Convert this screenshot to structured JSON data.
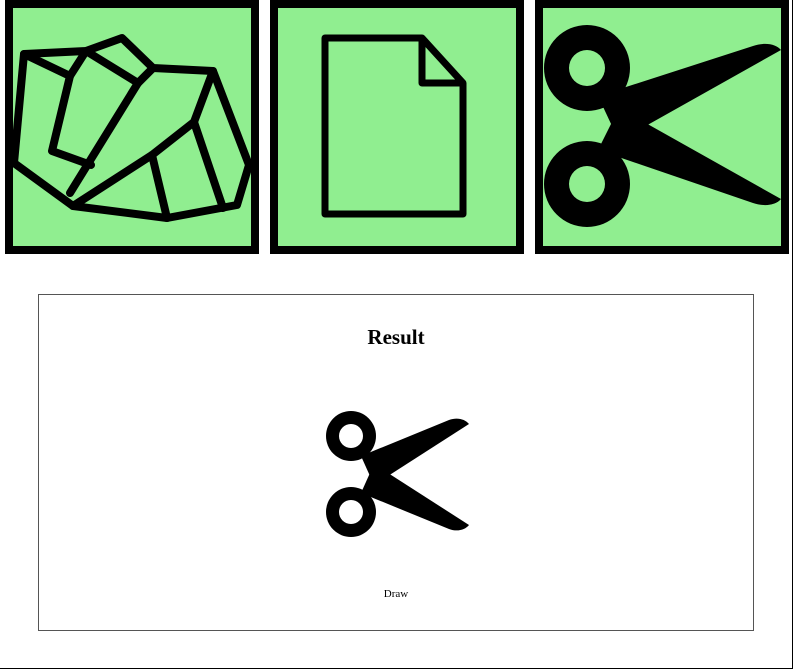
{
  "choices": [
    {
      "id": "rock",
      "icon": "rock-icon"
    },
    {
      "id": "paper",
      "icon": "paper-icon"
    },
    {
      "id": "scissors",
      "icon": "scissors-icon"
    }
  ],
  "colors": {
    "tile_background": "#90ee90",
    "tile_border": "#000000",
    "icon": "#000000",
    "panel_border": "#555555"
  },
  "result": {
    "title": "Result",
    "icon": "scissors-icon",
    "status": "Draw"
  }
}
